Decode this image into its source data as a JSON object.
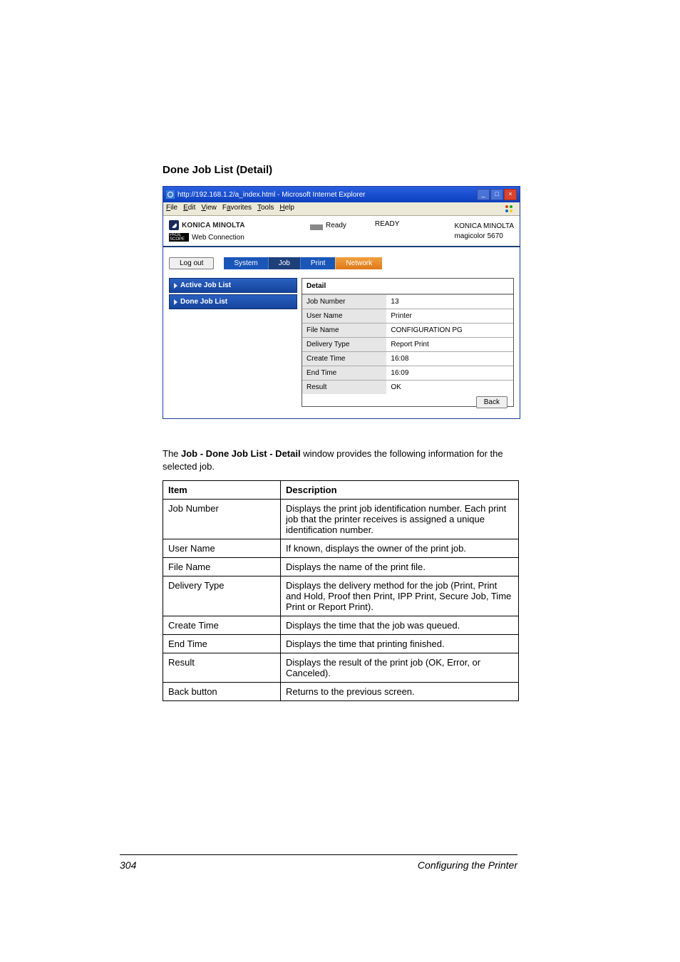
{
  "section_title": "Done Job List (Detail)",
  "browser": {
    "title": "http://192.168.1.2/a_index.html - Microsoft Internet Explorer",
    "menus": [
      "File",
      "Edit",
      "View",
      "Favorites",
      "Tools",
      "Help"
    ],
    "brand": "KONICA MINOLTA",
    "ps_badge": "PAGE SCOPE",
    "webconn": "Web Connection",
    "ready_label": "Ready",
    "ready_status": "READY",
    "product_line1": "KONICA MINOLTA",
    "product_line2": "magicolor 5670",
    "logout": "Log out",
    "tabs": {
      "system": "System",
      "job": "Job",
      "print": "Print",
      "network": "Network"
    },
    "sidebar": {
      "active": "Active Job List",
      "done": "Done Job List"
    },
    "panel_title": "Detail",
    "rows": [
      {
        "k": "Job Number",
        "v": "13"
      },
      {
        "k": "User Name",
        "v": "Printer"
      },
      {
        "k": "File Name",
        "v": "CONFIGURATION PG"
      },
      {
        "k": "Delivery Type",
        "v": "Report Print"
      },
      {
        "k": "Create Time",
        "v": "16:08"
      },
      {
        "k": "End Time",
        "v": "16:09"
      },
      {
        "k": "Result",
        "v": "OK"
      }
    ],
    "back": "Back"
  },
  "intro_pre": "The ",
  "intro_bold": "Job - Done Job List - Detail",
  "intro_post": " window provides the following information for the selected job.",
  "table_head": {
    "item": "Item",
    "desc": "Description"
  },
  "table_rows": [
    {
      "item": "Job Number",
      "desc": "Displays the print job identification number. Each print job that the printer receives is assigned a unique identification number."
    },
    {
      "item": "User Name",
      "desc": "If known, displays the owner of the print job."
    },
    {
      "item": "File Name",
      "desc": "Displays the name of the print file."
    },
    {
      "item": "Delivery Type",
      "desc": "Displays the delivery method for the job (Print, Print and Hold, Proof then Print, IPP Print, Secure Job, Time Print or Report Print)."
    },
    {
      "item": "Create Time",
      "desc": "Displays the time that the job was queued."
    },
    {
      "item": "End Time",
      "desc": "Displays the time that printing finished."
    },
    {
      "item": "Result",
      "desc": "Displays the result of the print job (OK, Error, or Canceled)."
    },
    {
      "item": "Back button",
      "desc": "Returns to the previous screen."
    }
  ],
  "footer": {
    "page": "304",
    "chapter": "Configuring the Printer"
  }
}
